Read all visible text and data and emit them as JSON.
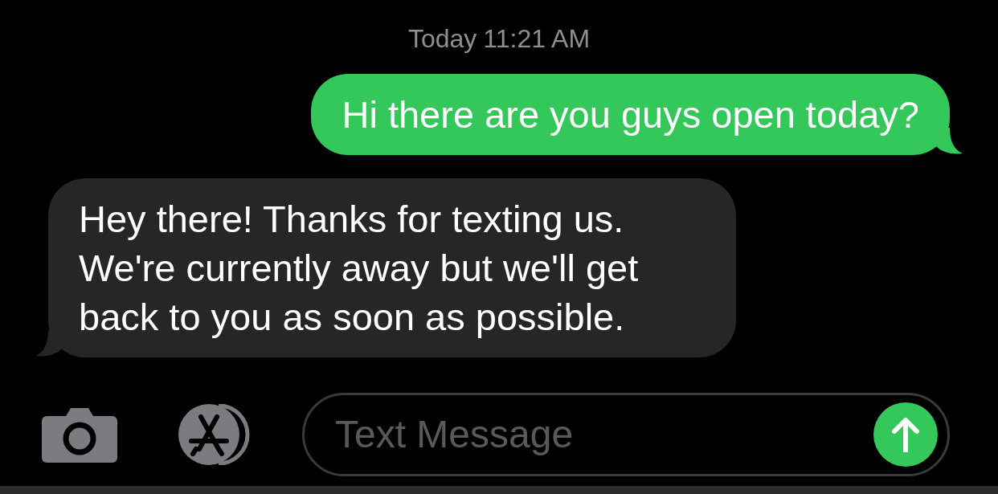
{
  "timestamp": {
    "day": "Today",
    "time": "11:21 AM"
  },
  "messages": [
    {
      "kind": "sent",
      "text": "Hi there are you guys open today?"
    },
    {
      "kind": "received",
      "text": "Hey there! Thanks for texting us. We're currently away but we'll get back to you as soon as possible."
    }
  ],
  "composer": {
    "placeholder": "Text Message"
  }
}
